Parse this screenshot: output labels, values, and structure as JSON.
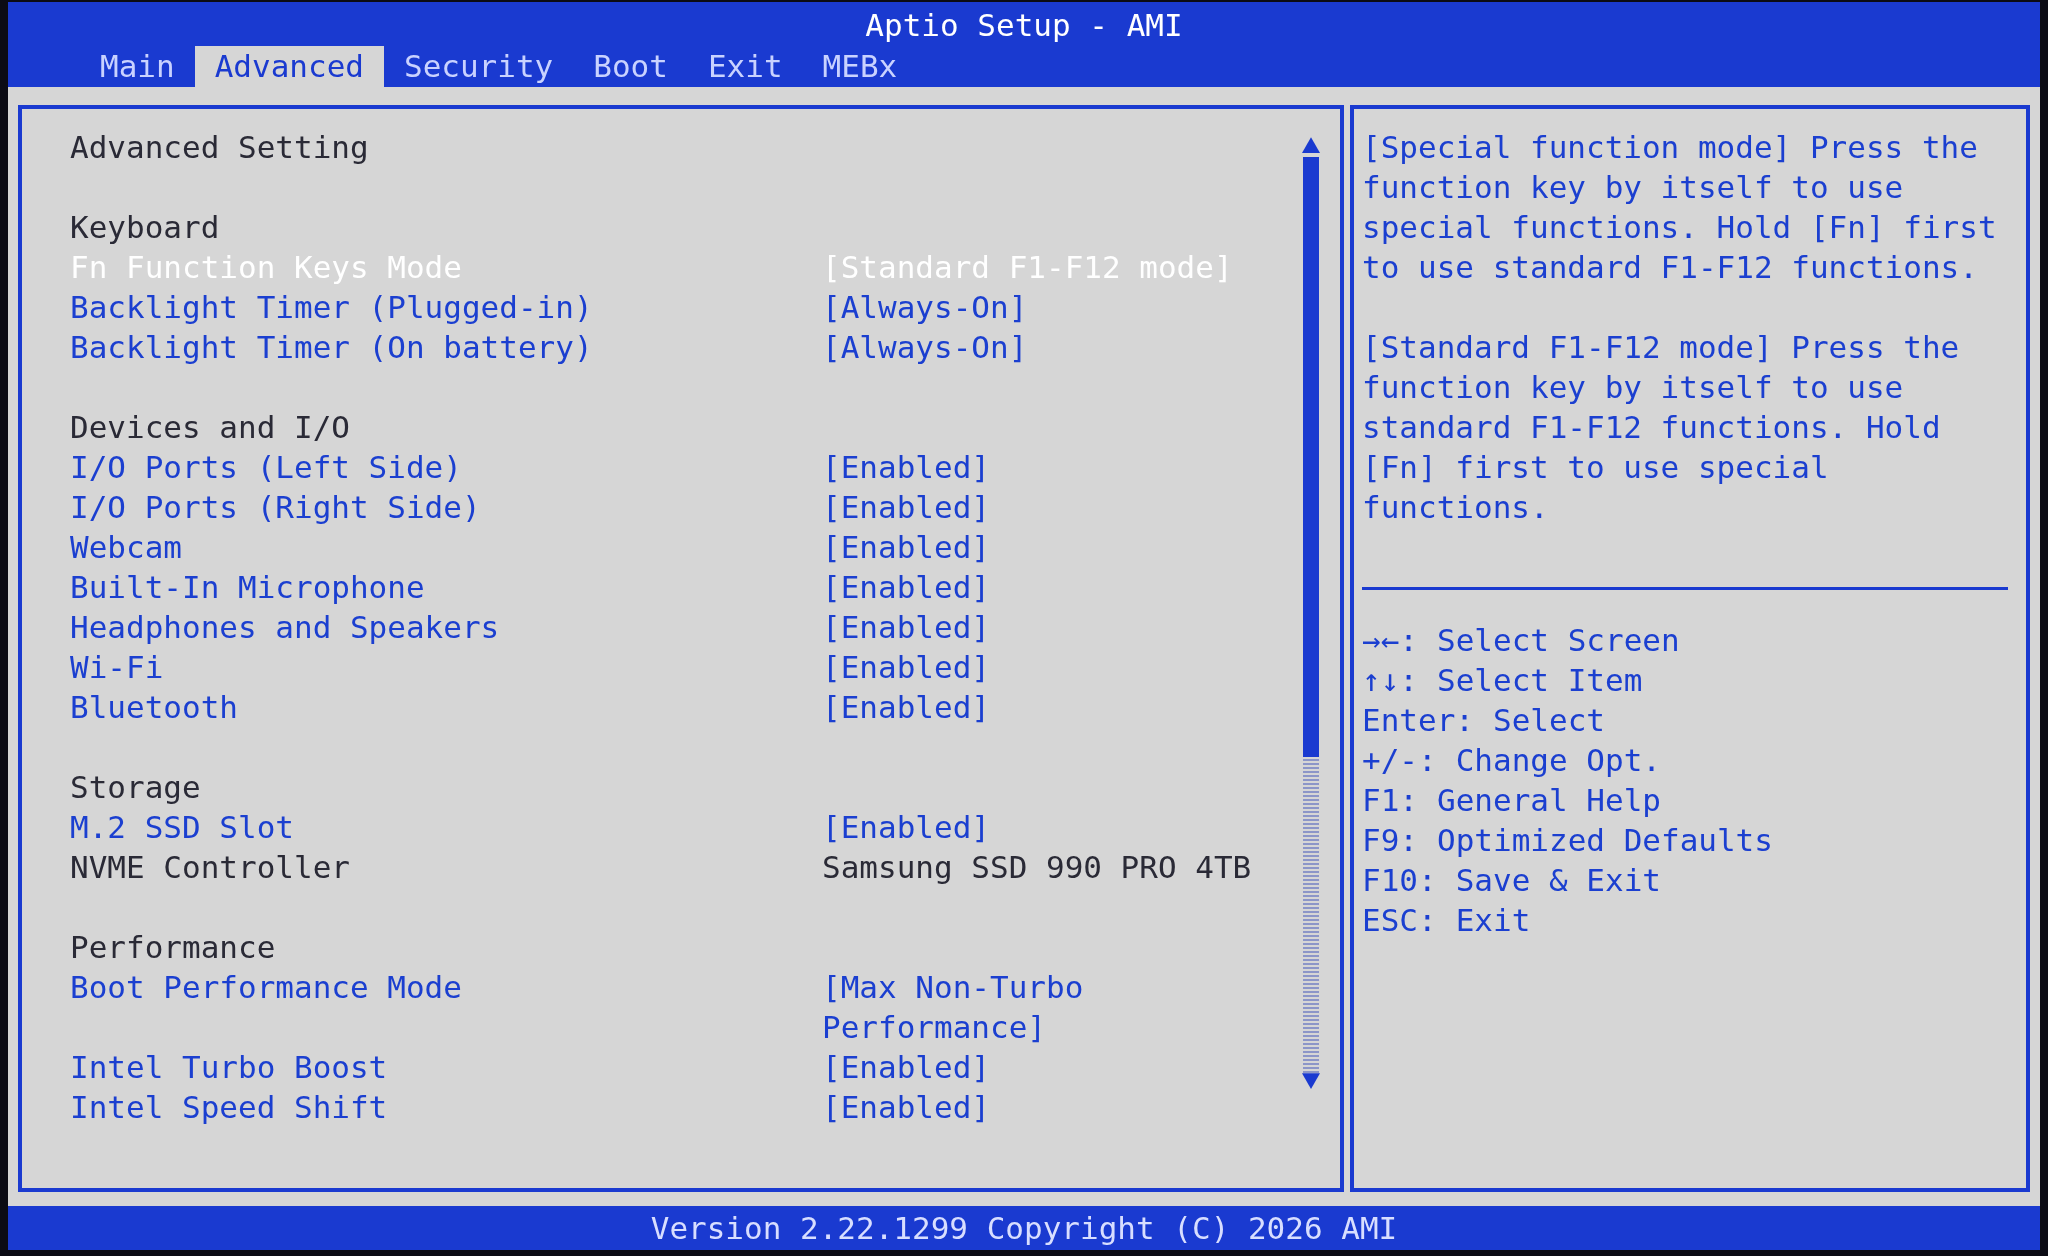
{
  "window": {
    "title": "Aptio Setup - AMI"
  },
  "tabs": [
    {
      "label": "Main",
      "selected": false
    },
    {
      "label": "Advanced",
      "selected": true
    },
    {
      "label": "Security",
      "selected": false
    },
    {
      "label": "Boot",
      "selected": false
    },
    {
      "label": "Exit",
      "selected": false
    },
    {
      "label": "MEBx",
      "selected": false
    }
  ],
  "page": {
    "title": "Advanced Setting",
    "items": [
      {
        "kind": "heading",
        "label": "Keyboard"
      },
      {
        "kind": "option",
        "label": "Fn Function Keys Mode",
        "value": "[Standard F1-F12 mode]",
        "selected": true
      },
      {
        "kind": "option",
        "label": "Backlight Timer (Plugged-in)",
        "value": "[Always-On]",
        "selected": false
      },
      {
        "kind": "option",
        "label": "Backlight Timer (On battery)",
        "value": "[Always-On]",
        "selected": false
      },
      {
        "kind": "heading",
        "label": "Devices and I/O"
      },
      {
        "kind": "option",
        "label": "I/O Ports (Left Side)",
        "value": "[Enabled]",
        "selected": false
      },
      {
        "kind": "option",
        "label": "I/O Ports (Right Side)",
        "value": "[Enabled]",
        "selected": false
      },
      {
        "kind": "option",
        "label": "Webcam",
        "value": "[Enabled]",
        "selected": false
      },
      {
        "kind": "option",
        "label": "Built-In Microphone",
        "value": "[Enabled]",
        "selected": false
      },
      {
        "kind": "option",
        "label": "Headphones and Speakers",
        "value": "[Enabled]",
        "selected": false
      },
      {
        "kind": "option",
        "label": "Wi-Fi",
        "value": "[Enabled]",
        "selected": false
      },
      {
        "kind": "option",
        "label": "Bluetooth",
        "value": "[Enabled]",
        "selected": false
      },
      {
        "kind": "heading",
        "label": "Storage"
      },
      {
        "kind": "option",
        "label": "M.2 SSD Slot",
        "value": "[Enabled]",
        "selected": false
      },
      {
        "kind": "info",
        "label": "NVME Controller",
        "value": "Samsung SSD 990 PRO 4TB"
      },
      {
        "kind": "heading",
        "label": "Performance"
      },
      {
        "kind": "option",
        "label": "Boot Performance Mode",
        "value": "[Max Non-Turbo Performance]",
        "selected": false
      },
      {
        "kind": "option",
        "label": "Intel Turbo Boost",
        "value": "[Enabled]",
        "selected": false
      },
      {
        "kind": "option",
        "label": "Intel Speed Shift",
        "value": "[Enabled]",
        "selected": false
      }
    ]
  },
  "help": [
    "[Special function mode] Press the function key by itself to use special functions. Hold [Fn] first to use standard F1-F12 functions.",
    "[Standard F1-F12 mode] Press the function key by itself to use standard F1-F12 functions. Hold [Fn] first to use special functions."
  ],
  "keys": [
    {
      "key": "→←:",
      "action": "Select Screen"
    },
    {
      "key": "↑↓:",
      "action": "Select Item"
    },
    {
      "key": "Enter:",
      "action": "Select"
    },
    {
      "key": "+/-:",
      "action": "Change Opt."
    },
    {
      "key": "F1:",
      "action": "General Help"
    },
    {
      "key": "F9:",
      "action": "Optimized Defaults"
    },
    {
      "key": "F10:",
      "action": "Save & Exit"
    },
    {
      "key": "ESC:",
      "action": "Exit"
    }
  ],
  "status_bar": "Version 2.22.1299 Copyright (C) 2026 AMI"
}
